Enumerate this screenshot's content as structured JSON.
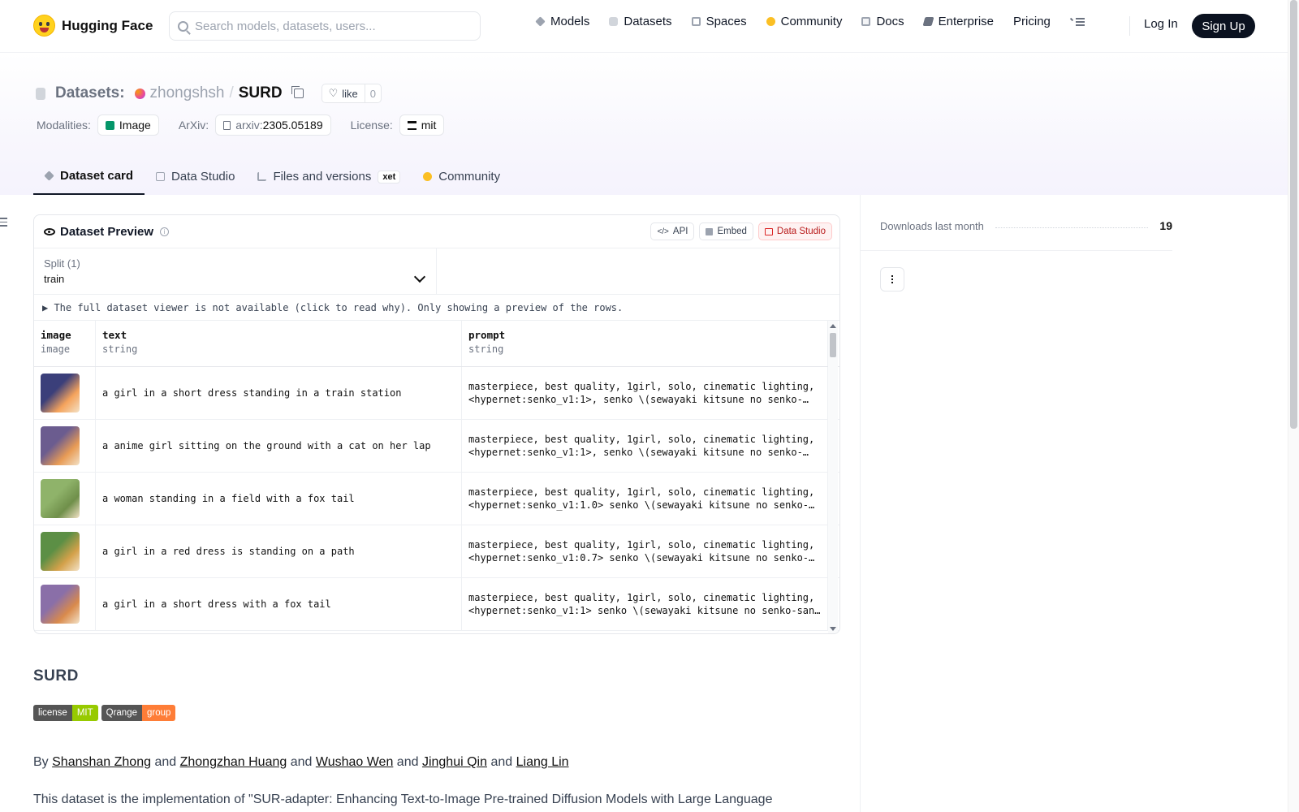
{
  "nav": {
    "brand": "Hugging Face",
    "search_placeholder": "Search models, datasets, users...",
    "links": [
      {
        "label": "Models",
        "icon": "cube-icon",
        "color": "#9ca3af"
      },
      {
        "label": "Datasets",
        "icon": "database-icon",
        "color": "#d1d5db"
      },
      {
        "label": "Spaces",
        "icon": "grid-icon",
        "color": "#9ca3af"
      },
      {
        "label": "Community",
        "icon": "community-icon",
        "color": "#fbbf24"
      },
      {
        "label": "Docs",
        "icon": "book-icon",
        "color": "#9ca3af"
      },
      {
        "label": "Enterprise",
        "icon": "enterprise-icon",
        "color": "#6b7280"
      },
      {
        "label": "Pricing",
        "icon": "",
        "color": ""
      }
    ],
    "login": "Log In",
    "signup": "Sign Up"
  },
  "header": {
    "section": "Datasets:",
    "owner": "zhongshsh",
    "separator": "/",
    "name": "SURD",
    "like_label": "like",
    "like_count": "0",
    "modalities_label": "Modalities:",
    "modality": "Image",
    "arxiv_label": "ArXiv:",
    "arxiv_prefix": "arxiv:",
    "arxiv_id": "2305.05189",
    "license_label": "License:",
    "license": "mit"
  },
  "tabs": [
    {
      "label": "Dataset card",
      "active": true
    },
    {
      "label": "Data Studio",
      "active": false
    },
    {
      "label": "Files and versions",
      "active": false,
      "badge": "xet"
    },
    {
      "label": "Community",
      "active": false
    }
  ],
  "preview": {
    "title": "Dataset Preview",
    "buttons": {
      "api": "API",
      "embed": "Embed",
      "studio": "Data Studio"
    },
    "split_label": "Split (1)",
    "split_value": "train",
    "notice": "▶ The full dataset viewer is not available (click to read why). Only showing a preview of the rows.",
    "columns": [
      {
        "name": "image",
        "type": "image"
      },
      {
        "name": "text",
        "type": "string"
      },
      {
        "name": "prompt",
        "type": "string"
      }
    ],
    "rows": [
      {
        "text": "a girl in a short dress standing in a train station",
        "prompt1": "masterpiece, best quality, 1girl, solo, cinematic lighting,",
        "prompt2": "<hypernet:senko_v1:1>, senko \\(sewayaki kitsune no senko-…",
        "thumb": [
          "#3b3f7a",
          "#f5a35c"
        ]
      },
      {
        "text": "a anime girl sitting on the ground with a cat on her lap",
        "prompt1": "masterpiece, best quality, 1girl, solo, cinematic lighting,",
        "prompt2": "<hypernet:senko_v1:1>, senko \\(sewayaki kitsune no senko-…",
        "thumb": [
          "#6b5c8f",
          "#e89b55"
        ]
      },
      {
        "text": "a woman standing in a field with a fox tail",
        "prompt1": "masterpiece, best quality, 1girl, solo, cinematic lighting,",
        "prompt2": "<hypernet:senko_v1:1.0> senko \\(sewayaki kitsune no senko-…",
        "thumb": [
          "#8fb36a",
          "#6f8f4a"
        ]
      },
      {
        "text": "a girl in a red dress is standing on a path",
        "prompt1": "masterpiece, best quality, 1girl, solo, cinematic lighting,",
        "prompt2": "<hypernet:senko_v1:0.7> senko \\(sewayaki kitsune no senko-…",
        "thumb": [
          "#5c8f45",
          "#d4a14a"
        ]
      },
      {
        "text": "a girl in a short dress with a fox tail",
        "prompt1": "masterpiece, best quality, 1girl, solo, cinematic lighting,",
        "prompt2": "<hypernet:senko_v1:1> senko \\(sewayaki kitsune no senko-san\\)…",
        "thumb": [
          "#8a6fa8",
          "#d98a4c"
        ]
      }
    ]
  },
  "readme": {
    "title": "SURD",
    "badges": [
      {
        "left": "license",
        "right": "MIT",
        "color": "#97ca00"
      },
      {
        "left": "Qrange",
        "right": "group",
        "color": "#fe7d37"
      }
    ],
    "by": "By",
    "and": "and",
    "authors": [
      "Shanshan Zhong",
      "Zhongzhan Huang",
      "Wushao Wen",
      "Jinghui Qin",
      "Liang Lin"
    ],
    "description": "This dataset is the implementation of \"SUR-adapter: Enhancing Text-to-Image Pre-trained Diffusion Models with Large Language"
  },
  "sidebar": {
    "downloads_label": "Downloads last month",
    "downloads_count": "19"
  }
}
